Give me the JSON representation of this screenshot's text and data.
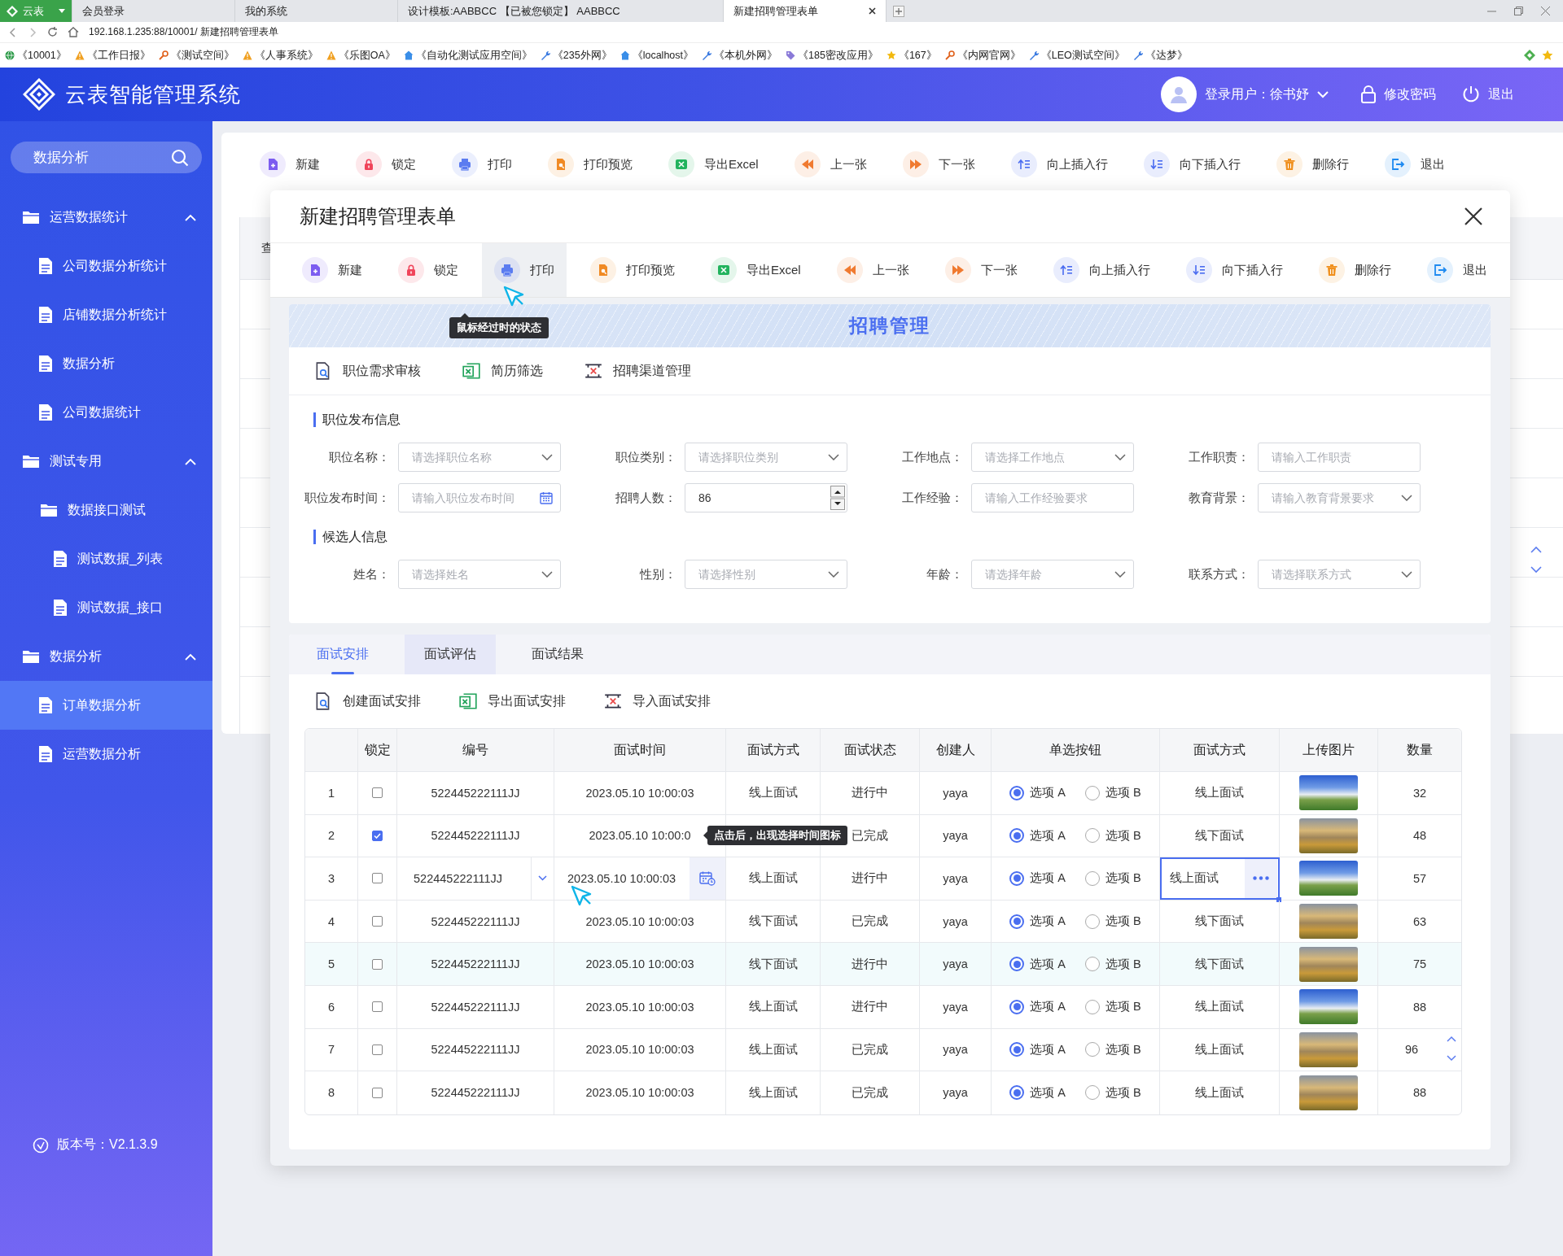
{
  "browser": {
    "tabs": [
      {
        "label": "云表",
        "kind": "brand",
        "selected": false
      },
      {
        "label": "会员登录",
        "kind": "page",
        "selected": false
      },
      {
        "label": "我的系统",
        "kind": "page",
        "selected": false
      },
      {
        "label": "设计模板:AABBCC 【已被您锁定】 AABBCC",
        "kind": "page",
        "selected": false
      },
      {
        "label": "新建招聘管理表单",
        "kind": "page",
        "selected": true
      }
    ],
    "address": "192.168.1.235:88/10001/ 新建招聘管理表单",
    "bookmarks": [
      {
        "label": "《10001》",
        "kind": "globe"
      },
      {
        "label": "《工作日报》",
        "kind": "warning"
      },
      {
        "label": "《测试空间》",
        "kind": "key"
      },
      {
        "label": "《人事系统》",
        "kind": "warning"
      },
      {
        "label": "《乐图OA》",
        "kind": "warning"
      },
      {
        "label": "《自动化测试应用空间》",
        "kind": "home"
      },
      {
        "label": "《235外网》",
        "kind": "tool"
      },
      {
        "label": "《localhost》",
        "kind": "home"
      },
      {
        "label": "《本机外网》",
        "kind": "tool"
      },
      {
        "label": "《185密改应用》",
        "kind": "tag"
      },
      {
        "label": "《167》",
        "kind": "star"
      },
      {
        "label": "《内网官网》",
        "kind": "key"
      },
      {
        "label": "《LEO测试空间》",
        "kind": "tool"
      },
      {
        "label": "《达梦》",
        "kind": "tool"
      }
    ]
  },
  "header": {
    "title": "云表智能管理系统",
    "user": "登录用户：徐书妤",
    "change_password": "修改密码",
    "logout": "退出"
  },
  "sidebar": {
    "search": {
      "value": "数据分析"
    },
    "menu": [
      {
        "label": "运营数据统计",
        "expanded": true,
        "children": [
          {
            "label": "公司数据分析统计",
            "kind": "page",
            "selected": false
          },
          {
            "label": "店铺数据分析统计",
            "kind": "page",
            "selected": false
          },
          {
            "label": "数据分析",
            "kind": "page",
            "selected": false
          },
          {
            "label": "公司数据统计",
            "kind": "page",
            "selected": false
          }
        ]
      },
      {
        "label": "测试专用",
        "expanded": true,
        "children": [
          {
            "label": "数据接口测试",
            "kind": "folder",
            "selected": false,
            "children": [
              {
                "label": "测试数据_列表",
                "kind": "page",
                "selected": false
              },
              {
                "label": "测试数据_接口",
                "kind": "page",
                "selected": false
              }
            ]
          }
        ]
      },
      {
        "label": "数据分析",
        "expanded": true,
        "children": [
          {
            "label": "订单数据分析",
            "kind": "page",
            "selected": true
          },
          {
            "label": "运营数据分析",
            "kind": "page",
            "selected": false
          }
        ]
      }
    ],
    "version": "版本号：V2.1.3.9"
  },
  "background": {
    "toolbar": [
      {
        "label": "新建",
        "kind": "new",
        "color": "#7c5cf0",
        "hovered": false
      },
      {
        "label": "锁定",
        "kind": "lock",
        "color": "#f0445a",
        "hovered": false
      },
      {
        "label": "打印",
        "kind": "print",
        "color": "#5b7cf0",
        "hovered": false
      },
      {
        "label": "打印预览",
        "kind": "preview",
        "color": "#f08a24",
        "hovered": false
      },
      {
        "label": "导出Excel",
        "kind": "excel",
        "color": "#22b35e",
        "hovered": false
      },
      {
        "label": "上一张",
        "kind": "prev",
        "color": "#f07a30",
        "hovered": false
      },
      {
        "label": "下一张",
        "kind": "next",
        "color": "#f07a30",
        "hovered": false
      },
      {
        "label": "向上插入行",
        "kind": "insert_up",
        "color": "#4a6cf0",
        "hovered": false
      },
      {
        "label": "向下插入行",
        "kind": "insert_down",
        "color": "#4a6cf0",
        "hovered": false
      },
      {
        "label": "删除行",
        "kind": "delete",
        "color": "#f0901e",
        "hovered": false
      },
      {
        "label": "退出",
        "kind": "exit",
        "color": "#1e8af0",
        "hovered": false
      }
    ],
    "table_label": "查"
  },
  "modal": {
    "title": "新建招聘管理表单",
    "toolbar": [
      {
        "label": "新建",
        "kind": "new",
        "color": "#7c5cf0",
        "hovered": false
      },
      {
        "label": "锁定",
        "kind": "lock",
        "color": "#f0445a",
        "hovered": false
      },
      {
        "label": "打印",
        "kind": "print",
        "color": "#5b7cf0",
        "hovered": true
      },
      {
        "label": "打印预览",
        "kind": "preview",
        "color": "#f08a24",
        "hovered": false
      },
      {
        "label": "导出Excel",
        "kind": "excel",
        "color": "#22b35e",
        "hovered": false
      },
      {
        "label": "上一张",
        "kind": "prev",
        "color": "#f07a30",
        "hovered": false
      },
      {
        "label": "下一张",
        "kind": "next",
        "color": "#f07a30",
        "hovered": false
      },
      {
        "label": "向上插入行",
        "kind": "insert_up",
        "color": "#4a6cf0",
        "hovered": false
      },
      {
        "label": "向下插入行",
        "kind": "insert_down",
        "color": "#4a6cf0",
        "hovered": false
      },
      {
        "label": "删除行",
        "kind": "delete",
        "color": "#f0901e",
        "hovered": false
      },
      {
        "label": "退出",
        "kind": "exit",
        "color": "#1e8af0",
        "hovered": false
      }
    ],
    "toolbar_tooltip": "鼠标经过时的状态",
    "banner": "招聘管理",
    "links": [
      {
        "label": "职位需求审核",
        "kind": "audit"
      },
      {
        "label": "简历筛选",
        "kind": "excel"
      },
      {
        "label": "招聘渠道管理",
        "kind": "channel"
      }
    ],
    "sections": [
      {
        "title": "职位发布信息",
        "fields": [
          {
            "label": "职位名称：",
            "kind": "select",
            "placeholder": "请选择职位名称"
          },
          {
            "label": "职位类别：",
            "kind": "select",
            "placeholder": "请选择职位类别"
          },
          {
            "label": "工作地点：",
            "kind": "select",
            "placeholder": "请选择工作地点"
          },
          {
            "label": "工作职责：",
            "kind": "text",
            "placeholder": "请输入工作职责"
          },
          {
            "label": "职位发布时间：",
            "kind": "date",
            "placeholder": "请输入职位发布时间"
          },
          {
            "label": "招聘人数：",
            "kind": "number",
            "value": "86"
          },
          {
            "label": "工作经验：",
            "kind": "text",
            "placeholder": "请输入工作经验要求"
          },
          {
            "label": "教育背景：",
            "kind": "select",
            "placeholder": "请输入教育背景要求"
          }
        ]
      },
      {
        "title": "候选人信息",
        "fields": [
          {
            "label": "姓名：",
            "kind": "select",
            "placeholder": "请选择姓名"
          },
          {
            "label": "性别：",
            "kind": "select",
            "placeholder": "请选择性别"
          },
          {
            "label": "年龄：",
            "kind": "select",
            "placeholder": "请选择年龄"
          },
          {
            "label": "联系方式：",
            "kind": "select",
            "placeholder": "请选择联系方式"
          }
        ]
      }
    ],
    "detail": {
      "tabs": [
        {
          "label": "面试安排",
          "selected": true,
          "hovered": false
        },
        {
          "label": "面试评估",
          "selected": false,
          "hovered": true
        },
        {
          "label": "面试结果",
          "selected": false,
          "hovered": false
        }
      ],
      "actions": [
        {
          "label": "创建面试安排",
          "kind": "audit"
        },
        {
          "label": "导出面试安排",
          "kind": "excel"
        },
        {
          "label": "导入面试安排",
          "kind": "channel"
        }
      ],
      "columns": [
        "锁定",
        "编号",
        "面试时间",
        "面试方式",
        "面试状态",
        "创建人",
        "单选按钮",
        "面试方式",
        "上传图片",
        "数量"
      ],
      "rows": [
        {
          "no": "1",
          "locked": false,
          "code": "522445222111JJ",
          "time": "2023.05.10 10:00:03",
          "mode": "线上面试",
          "status": "进行中",
          "creator": "yaya",
          "options": [
            {
              "label": "选项 A",
              "selected": true
            },
            {
              "label": "选项 B",
              "selected": false
            }
          ],
          "mode_2": "线上面试",
          "photo": {
            "kind": "sky"
          },
          "quantity": "32",
          "editing": false,
          "hovered": false,
          "stepper": false
        },
        {
          "no": "2",
          "locked": true,
          "code": "522445222111JJ",
          "time": "2023.05.10 10:00:0",
          "status": "已完成",
          "creator": "yaya",
          "options": [
            {
              "label": "选项 A",
              "selected": true
            },
            {
              "label": "选项 B",
              "selected": false
            }
          ],
          "mode_2": "线下面试",
          "photo": {
            "kind": "hills"
          },
          "quantity": "48",
          "editing": false,
          "hovered": false,
          "stepper": false,
          "tooltip": "点击后，出现选择时间图标"
        },
        {
          "no": "3",
          "locked": false,
          "code": "522445222111JJ",
          "time": "2023.05.10 10:00:03",
          "mode": "线上面试",
          "status": "进行中",
          "creator": "yaya",
          "options": [
            {
              "label": "选项 A",
              "selected": true
            },
            {
              "label": "选项 B",
              "selected": false
            }
          ],
          "mode_2": "线上面试",
          "photo": {
            "kind": "sky"
          },
          "quantity": "57",
          "editing": true,
          "hovered": false,
          "stepper": false
        },
        {
          "no": "4",
          "locked": false,
          "code": "522445222111JJ",
          "time": "2023.05.10 10:00:03",
          "mode": "线下面试",
          "status": "已完成",
          "creator": "yaya",
          "options": [
            {
              "label": "选项 A",
              "selected": true
            },
            {
              "label": "选项 B",
              "selected": false
            }
          ],
          "mode_2": "线下面试",
          "photo": {
            "kind": "hills"
          },
          "quantity": "63",
          "editing": false,
          "hovered": false,
          "stepper": false
        },
        {
          "no": "5",
          "locked": false,
          "code": "522445222111JJ",
          "time": "2023.05.10 10:00:03",
          "mode": "线下面试",
          "status": "进行中",
          "creator": "yaya",
          "options": [
            {
              "label": "选项 A",
              "selected": true
            },
            {
              "label": "选项 B",
              "selected": false
            }
          ],
          "mode_2": "线下面试",
          "photo": {
            "kind": "hills"
          },
          "quantity": "75",
          "editing": false,
          "hovered": true,
          "stepper": false
        },
        {
          "no": "6",
          "locked": false,
          "code": "522445222111JJ",
          "time": "2023.05.10 10:00:03",
          "mode": "线上面试",
          "status": "进行中",
          "creator": "yaya",
          "options": [
            {
              "label": "选项 A",
              "selected": true
            },
            {
              "label": "选项 B",
              "selected": false
            }
          ],
          "mode_2": "线上面试",
          "photo": {
            "kind": "sky"
          },
          "quantity": "88",
          "editing": false,
          "hovered": false,
          "stepper": false
        },
        {
          "no": "7",
          "locked": false,
          "code": "522445222111JJ",
          "time": "2023.05.10 10:00:03",
          "mode": "线上面试",
          "status": "已完成",
          "creator": "yaya",
          "options": [
            {
              "label": "选项 A",
              "selected": true
            },
            {
              "label": "选项 B",
              "selected": false
            }
          ],
          "mode_2": "线上面试",
          "photo": {
            "kind": "hills"
          },
          "quantity": "96",
          "editing": false,
          "hovered": false,
          "stepper": true
        },
        {
          "no": "8",
          "locked": false,
          "code": "522445222111JJ",
          "time": "2023.05.10 10:00:03",
          "mode": "线上面试",
          "status": "已完成",
          "creator": "yaya",
          "options": [
            {
              "label": "选项 A",
              "selected": true
            },
            {
              "label": "选项 B",
              "selected": false
            }
          ],
          "mode_2": "线上面试",
          "photo": {
            "kind": "hills"
          },
          "quantity": "88",
          "editing": false,
          "hovered": false,
          "stepper": false
        }
      ]
    }
  }
}
